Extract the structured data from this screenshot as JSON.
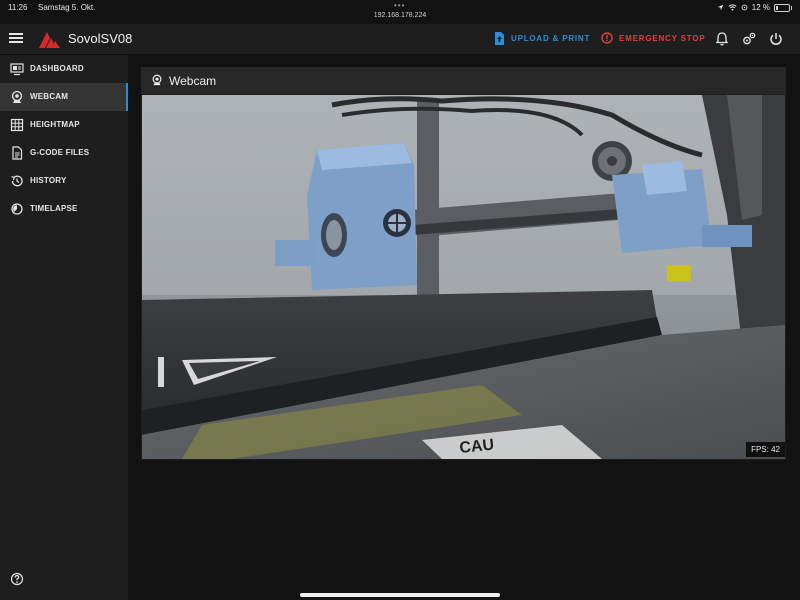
{
  "status_bar": {
    "time": "11:26",
    "date": "Samstag 5. Okt.",
    "url": "192.168.178.224",
    "battery": "12 %"
  },
  "header": {
    "title": "SovolSV08",
    "upload_label": "UPLOAD & PRINT",
    "estop_label": "EMERGENCY STOP",
    "icons": [
      "menu-icon",
      "bell-icon",
      "settings-icon",
      "power-icon"
    ]
  },
  "sidebar": {
    "items": [
      {
        "label": "DASHBOARD",
        "icon": "monitor-icon"
      },
      {
        "label": "WEBCAM",
        "icon": "webcam-icon",
        "active": true
      },
      {
        "label": "HEIGHTMAP",
        "icon": "grid-icon"
      },
      {
        "label": "G-CODE FILES",
        "icon": "file-icon"
      },
      {
        "label": "HISTORY",
        "icon": "history-icon"
      },
      {
        "label": "TIMELAPSE",
        "icon": "timelapse-icon"
      }
    ],
    "help_icon": "help-icon"
  },
  "webcam_panel": {
    "title": "Webcam",
    "fps_label": "FPS:",
    "fps_value": "42"
  },
  "colors": {
    "accent": "#2b8fd8",
    "danger": "#e0403a",
    "panel": "#1e1e1e",
    "background": "#121212"
  }
}
